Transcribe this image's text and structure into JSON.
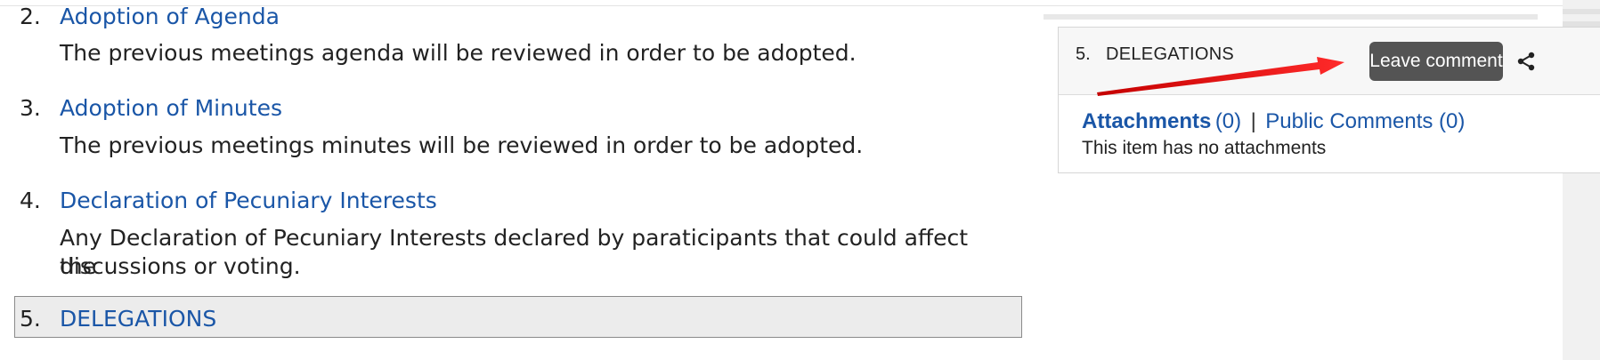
{
  "agenda": {
    "items": [
      {
        "number": "2.",
        "title": "Adoption of Agenda",
        "description": "The previous meetings agenda will be reviewed in order to be adopted."
      },
      {
        "number": "3.",
        "title": "Adoption of Minutes",
        "description": "The previous meetings minutes will be reviewed in order to be adopted."
      },
      {
        "number": "4.",
        "title": "Declaration of Pecuniary Interests",
        "description_line1": "Any Declaration of Pecuniary Interests declared by paraticipants that could affect the",
        "description_line2": "discussions or voting."
      },
      {
        "number": "5.",
        "title": "DELEGATIONS"
      }
    ]
  },
  "panel": {
    "number": "5.",
    "title": "DELEGATIONS",
    "leave_comment_label": "Leave comment",
    "share_icon": "share-icon",
    "attachments_label": "Attachments",
    "attachments_count": "(0)",
    "separator": "|",
    "public_comments_label": "Public Comments (0)",
    "no_attachments_text": "This item has no attachments"
  },
  "annotation": {
    "arrow_color": "#e31b1b"
  },
  "colors": {
    "link": "#1a56a7",
    "button": "#545454",
    "highlight": "#ececec"
  }
}
